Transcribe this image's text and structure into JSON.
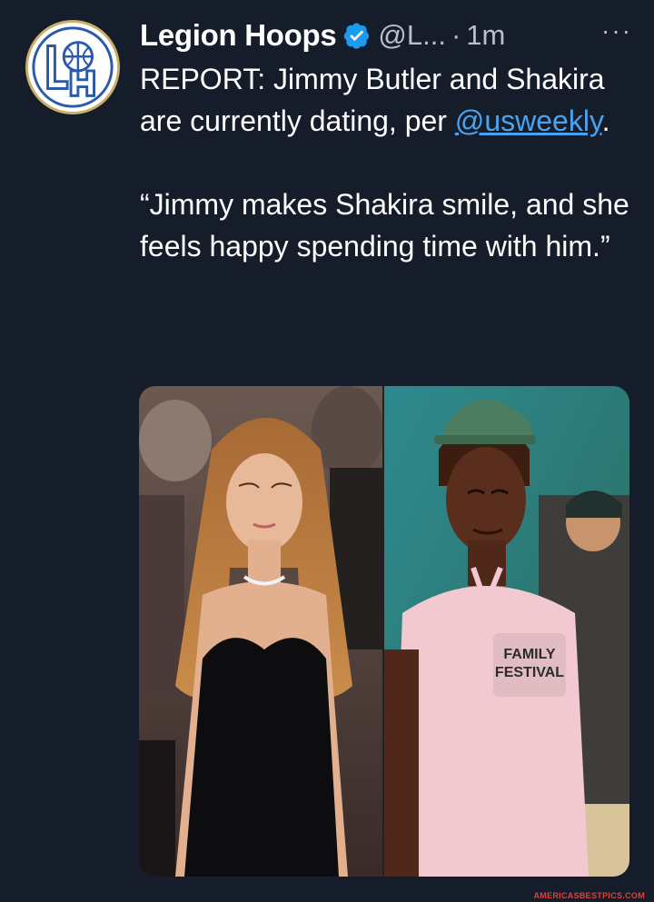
{
  "tweet": {
    "author_name": "Legion Hoops",
    "handle": "@L...",
    "separator": "·",
    "time": "1m",
    "more_label": "···",
    "avatar_text": "LH",
    "line1_pre": "REPORT: Jimmy Butler and Shakira are currently dating, per ",
    "mention": "@usweekly",
    "line1_post": ".",
    "quote": "“Jimmy makes Shakira smile, and she feels happy spending time with him.”"
  },
  "media": {
    "left_photo": "woman-in-black-dress-photo",
    "right_photo": "man-in-pink-shirt-photo",
    "shirt_text": [
      "FAMILY",
      "FESTIVAL"
    ]
  },
  "watermark": "AMERICASBESTPICS.COM",
  "colors": {
    "background": "#151c2a",
    "link": "#4aa3f0",
    "verified": "#1d9bf0",
    "muted": "#b9c0cc"
  }
}
